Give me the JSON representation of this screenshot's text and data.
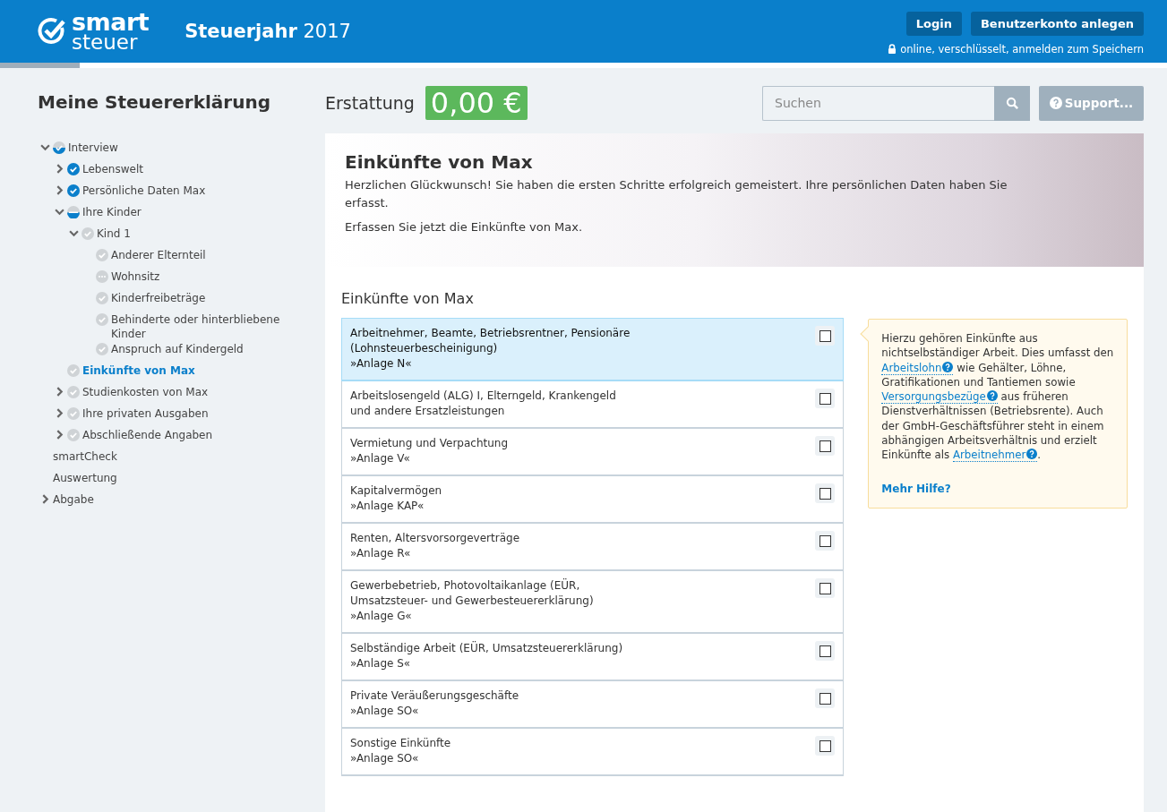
{
  "header": {
    "logo": {
      "word_1": "smart",
      "word_2": "steuer"
    },
    "title": "**Steuerjahr** 2017",
    "buttons": [
      "Login",
      "Benutzerkonto anlegen"
    ],
    "security_note": "online, verschlüsselt, anmelden zum Speichern",
    "progress": {
      "level": 0.068
    }
  },
  "sidebar": {
    "title": "Meine Steuererklärung",
    "tree": [
      {
        "label": "Interview",
        "kind": "partial",
        "expanded": true,
        "selected": false,
        "children": [
          {
            "label": "Lebenswelt",
            "kind": "done",
            "expanded": false,
            "selected": false
          },
          {
            "label": "Persönliche Daten Max",
            "kind": "done",
            "expanded": false,
            "selected": false
          },
          {
            "label": "Ihre Kinder",
            "kind": "half",
            "expanded": true,
            "selected": false,
            "children": [
              {
                "label": "Kind 1",
                "kind": "open",
                "expanded": true,
                "selected": false,
                "children": [
                  {
                    "label": "Anderer Elternteil",
                    "kind": "open",
                    "selected": false
                  },
                  {
                    "label": "Wohnsitz",
                    "kind": "pending",
                    "selected": false
                  },
                  {
                    "label": "Kinderfreibeträge",
                    "kind": "open",
                    "selected": false
                  },
                  {
                    "label": "Behinderte oder hinterbliebene Kinder",
                    "kind": "open",
                    "selected": false
                  },
                  {
                    "label": "Anspruch auf Kindergeld",
                    "kind": "open",
                    "selected": false
                  }
                ]
              }
            ]
          },
          {
            "label": "Einkünfte von Max",
            "kind": "open",
            "selected": true
          },
          {
            "label": "Studienkosten von Max",
            "kind": "open",
            "expanded": false,
            "selected": false
          },
          {
            "label": "Ihre privaten Ausgaben",
            "kind": "open",
            "expanded": false,
            "selected": false
          },
          {
            "label": "Abschließende Angaben",
            "kind": "open",
            "expanded": false,
            "selected": false
          }
        ]
      },
      {
        "label": "smartCheck",
        "selected": false
      },
      {
        "label": "Auswertung",
        "selected": false
      },
      {
        "label": "Abgabe",
        "expanded": false,
        "selected": false
      }
    ]
  },
  "refund": {
    "label": "Erstattung",
    "amount": "0,00 €"
  },
  "search": {
    "placeholder": "Suchen"
  },
  "support_button": "Support...",
  "hero": {
    "title": "Einkünfte von Max",
    "paragraphs": [
      "Herzlichen Glückwunsch! Sie haben die ersten Schritte erfolgreich gemeistert. Ihre persönlichen Daten haben Sie erfasst.",
      "Erfassen Sie jetzt die Einkünfte von Max."
    ]
  },
  "section_title": "Einkünfte von Max",
  "options": [
    {
      "lines": [
        "Arbeitnehmer, Beamte, Betriebsrentner, Pensionäre",
        "(Lohnsteuerbescheinigung)",
        "»Anlage N«"
      ],
      "selected": true,
      "checked": false
    },
    {
      "lines": [
        "Arbeitslosengeld (ALG) I, Elterngeld, Krankengeld",
        "und andere Ersatzleistungen"
      ],
      "selected": false,
      "checked": false
    },
    {
      "lines": [
        "Vermietung und Verpachtung",
        "»Anlage V«"
      ],
      "selected": false,
      "checked": false
    },
    {
      "lines": [
        "Kapitalvermögen",
        "»Anlage KAP«"
      ],
      "selected": false,
      "checked": false
    },
    {
      "lines": [
        "Renten, Altersvorsorgeverträge",
        "»Anlage R«"
      ],
      "selected": false,
      "checked": false
    },
    {
      "lines": [
        "Gewerbebetrieb, Photovoltaikanlage (EÜR,",
        "Umsatzsteuer- und Gewerbesteuererklärung)",
        "»Anlage G«"
      ],
      "selected": false,
      "checked": false
    },
    {
      "lines": [
        "Selbständige Arbeit (EÜR, Umsatzsteuererklärung)",
        "»Anlage S«"
      ],
      "selected": false,
      "checked": false
    },
    {
      "lines": [
        "Private Veräußerungsgeschäfte",
        "»Anlage SO«"
      ],
      "selected": false,
      "checked": false
    },
    {
      "lines": [
        "Sonstige Einkünfte",
        "»Anlage SO«"
      ],
      "selected": false,
      "checked": false
    }
  ],
  "help": {
    "segments": [
      {
        "kind": "text",
        "text": "Hierzu gehören Einkünfte aus nichtselbständiger Arbeit. Dies umfasst den "
      },
      {
        "kind": "link",
        "text": "Arbeitslohn"
      },
      {
        "kind": "text",
        "text": " wie Gehälter, Löhne, Gratifikationen und Tantiemen sowie "
      },
      {
        "kind": "link",
        "text": "Versorgungsbezüge"
      },
      {
        "kind": "text",
        "text": " aus früheren Dienstverhältnissen (Betriebsrente). Auch der GmbH-Geschäftsführer steht in einem abhängigen Arbeitsverhältnis und erzielt Einkünfte als "
      },
      {
        "kind": "link",
        "text": "Arbeitnehmer"
      },
      {
        "kind": "text",
        "text": "."
      }
    ],
    "more_link": "Mehr Hilfe?"
  }
}
